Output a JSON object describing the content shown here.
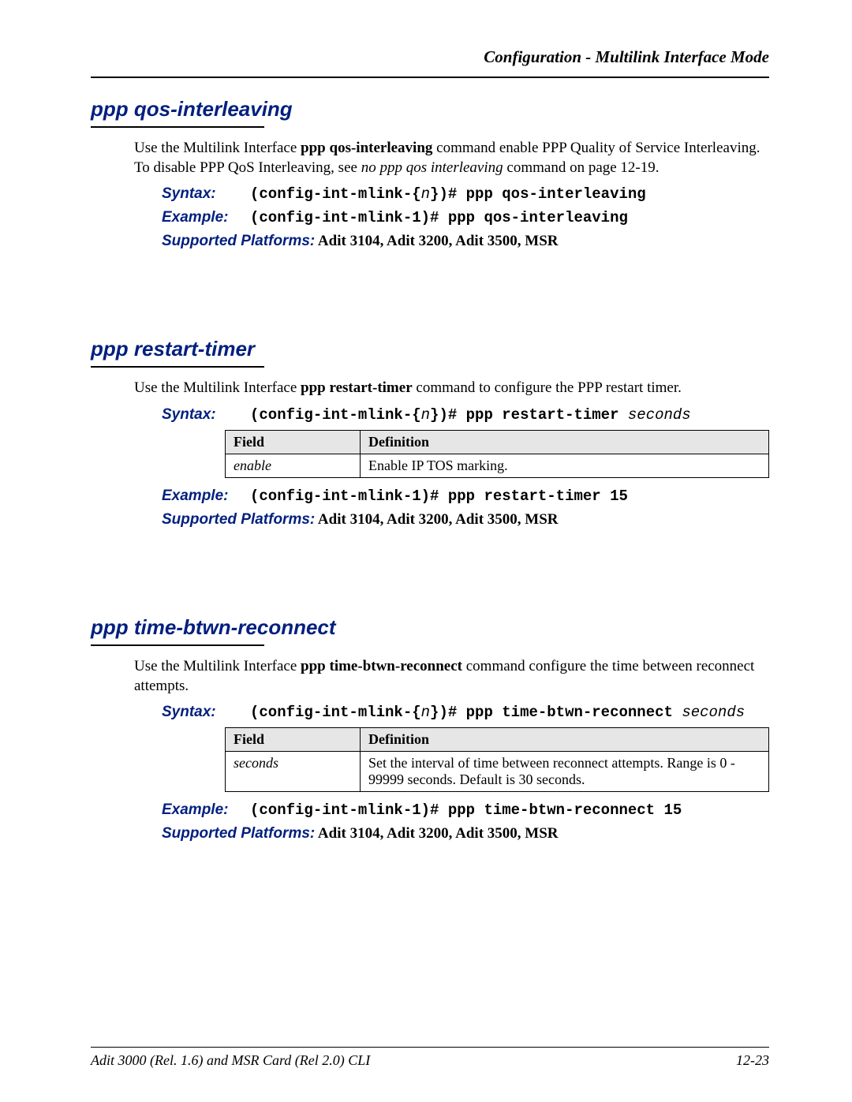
{
  "header": {
    "title": "Configuration - Multilink Interface Mode"
  },
  "sections": [
    {
      "title": "ppp qos-interleaving",
      "intro_pre": "Use the Multilink Interface ",
      "intro_bold": "ppp qos-interleaving",
      "intro_mid": " command enable PPP Quality of Service Interleaving. To disable PPP QoS Interleaving, see ",
      "intro_ital": "no ppp qos interleaving",
      "intro_post": " command on page 12-19.",
      "syntax_label": "Syntax:",
      "syntax_pre": "(config-int-mlink-{",
      "syntax_n": "n",
      "syntax_post": "})# ppp qos-interleaving",
      "example_label": "Example:",
      "example_code": "(config-int-mlink-1)# ppp qos-interleaving",
      "platforms_label": "Supported Platforms:",
      "platforms_val": "  Adit 3104, Adit 3200, Adit 3500, MSR"
    },
    {
      "title": "ppp restart-timer",
      "intro_pre": "Use the Multilink Interface ",
      "intro_bold": "ppp restart-timer",
      "intro_post": " command to configure the PPP restart timer.",
      "syntax_label": "Syntax:",
      "syntax_pre": "(config-int-mlink-{",
      "syntax_n": "n",
      "syntax_post": "})# ppp restart-timer ",
      "syntax_arg": "seconds",
      "table": {
        "h1": "Field",
        "h2": "Definition",
        "rows": [
          {
            "field": "enable",
            "def": "Enable IP TOS marking."
          }
        ]
      },
      "example_label": "Example:",
      "example_code": "(config-int-mlink-1)# ppp restart-timer 15",
      "platforms_label": "Supported Platforms:",
      "platforms_val": "  Adit 3104, Adit 3200, Adit 3500, MSR"
    },
    {
      "title": "ppp time-btwn-reconnect",
      "intro_pre": "Use the Multilink Interface ",
      "intro_bold": "ppp time-btwn-reconnect",
      "intro_post": " command configure the time between reconnect attempts.",
      "syntax_label": "Syntax:",
      "syntax_pre": "(config-int-mlink-{",
      "syntax_n": "n",
      "syntax_post": "})# ppp time-btwn-reconnect ",
      "syntax_arg": "seconds",
      "table": {
        "h1": "Field",
        "h2": "Definition",
        "rows": [
          {
            "field": "seconds",
            "def": "Set the interval of time between reconnect attempts. Range is 0 - 99999 seconds. Default is 30 seconds."
          }
        ]
      },
      "example_label": "Example:",
      "example_code": "(config-int-mlink-1)# ppp time-btwn-reconnect 15",
      "platforms_label": "Supported Platforms:",
      "platforms_val": "  Adit 3104, Adit 3200, Adit 3500, MSR"
    }
  ],
  "footer": {
    "left": "Adit 3000 (Rel. 1.6) and MSR Card (Rel 2.0) CLI",
    "right": "12-23"
  }
}
